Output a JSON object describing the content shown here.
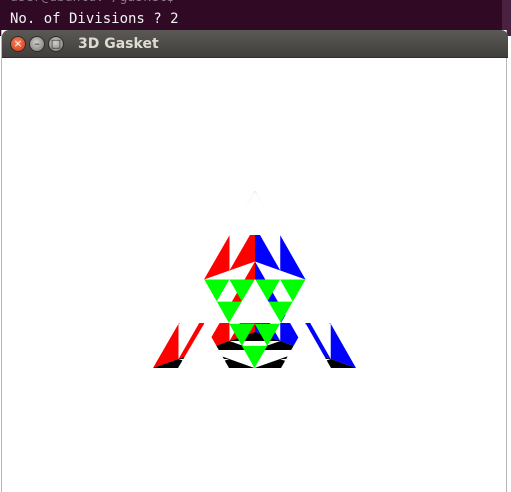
{
  "terminal": {
    "prompt": "No. of Divisions ? 2"
  },
  "window": {
    "title": "3D Gasket"
  },
  "colors": {
    "terminal_background": "#300a24",
    "titlebar": "#4f4e4a",
    "red": "#ff0000",
    "green": "#00ff00",
    "blue": "#0000ff",
    "black": "#000000",
    "white": "#ffffff"
  },
  "icons": {
    "close": "close-icon",
    "minimize": "minimize-icon",
    "maximize": "maximize-icon"
  }
}
